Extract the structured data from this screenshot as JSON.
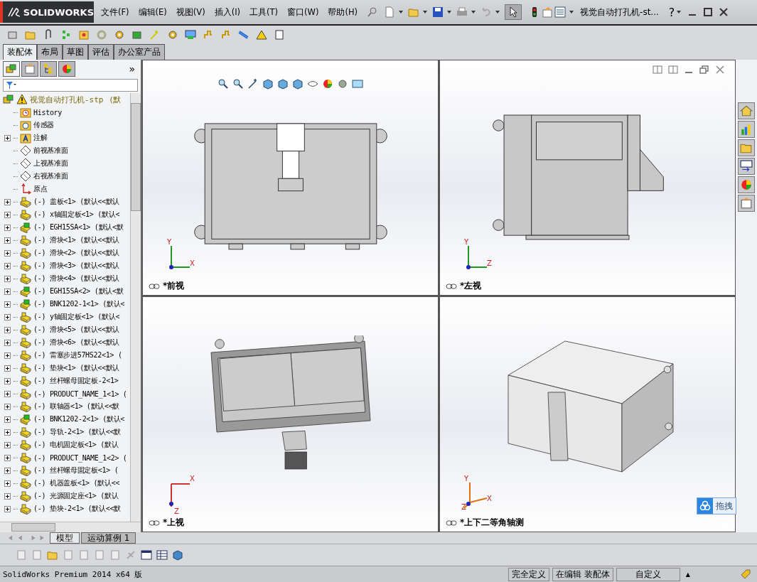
{
  "window": {
    "logo": "SOLIDWORKS",
    "title": "视觉自动打孔机-st...",
    "help": "?"
  },
  "menus": [
    "文件(F)",
    "编辑(E)",
    "视图(V)",
    "插入(I)",
    "工具(T)",
    "窗口(W)",
    "帮助(H)"
  ],
  "command_tabs": [
    {
      "label": "装配体",
      "selected": true
    },
    {
      "label": "布局",
      "selected": false
    },
    {
      "label": "草图",
      "selected": false
    },
    {
      "label": "评估",
      "selected": false
    },
    {
      "label": "办公室产品",
      "selected": false
    }
  ],
  "manager_tabs": [
    {
      "kind": "assembly",
      "selected": true
    },
    {
      "kind": "property",
      "selected": false
    },
    {
      "kind": "config",
      "selected": false
    },
    {
      "kind": "display",
      "selected": false
    }
  ],
  "manager_more": "»",
  "tree": {
    "root": {
      "label": "视觉自动打孔机-stp",
      "config": "(默",
      "warning": true
    },
    "items": [
      {
        "kind": "history",
        "label": "History",
        "expandable": false
      },
      {
        "kind": "sensor",
        "label": "传感器",
        "expandable": false
      },
      {
        "kind": "annotation",
        "label": "注解",
        "expandable": true
      },
      {
        "kind": "plane",
        "label": "前视基准面",
        "expandable": false
      },
      {
        "kind": "plane",
        "label": "上视基准面",
        "expandable": false
      },
      {
        "kind": "plane",
        "label": "右视基准面",
        "expandable": false
      },
      {
        "kind": "origin",
        "label": "原点",
        "expandable": false
      },
      {
        "kind": "part",
        "label": "(-) 盖板<1> (默认<<默认",
        "expandable": true
      },
      {
        "kind": "part",
        "label": "(-) x轴固定板<1> (默认<",
        "expandable": true
      },
      {
        "kind": "assembly",
        "label": "(-) EGH15SA<1> (默认<默",
        "expandable": true
      },
      {
        "kind": "part",
        "label": "(-) 滑块<1> (默认<<默认",
        "expandable": true
      },
      {
        "kind": "part",
        "label": "(-) 滑块<2> (默认<<默认",
        "expandable": true
      },
      {
        "kind": "part",
        "label": "(-) 滑块<3> (默认<<默认",
        "expandable": true
      },
      {
        "kind": "part",
        "label": "(-) 滑块<4> (默认<<默认",
        "expandable": true
      },
      {
        "kind": "assembly",
        "label": "(-) EGH15SA<2> (默认<默",
        "expandable": true
      },
      {
        "kind": "assembly",
        "label": "(-) BNK1202-1<1> (默认<",
        "expandable": true
      },
      {
        "kind": "part",
        "label": "(-) y轴固定板<1> (默认<",
        "expandable": true
      },
      {
        "kind": "part",
        "label": "(-) 滑块<5> (默认<<默认",
        "expandable": true
      },
      {
        "kind": "part",
        "label": "(-) 滑块<6> (默认<<默认",
        "expandable": true
      },
      {
        "kind": "part",
        "label": "(-) 雷塞步进57HS22<1> (",
        "expandable": true
      },
      {
        "kind": "part",
        "label": "(-) 垫块<1> (默认<<默认",
        "expandable": true
      },
      {
        "kind": "part",
        "label": "(-) 丝杆螺母固定板-2<1>",
        "expandable": true
      },
      {
        "kind": "part",
        "label": "(-) PRODUCT_NAME_1<1> (",
        "expandable": true
      },
      {
        "kind": "part",
        "label": "(-) 联轴器<1> (默认<<默",
        "expandable": true
      },
      {
        "kind": "assembly",
        "label": "(-) BNK1202-2<1> (默认<",
        "expandable": true
      },
      {
        "kind": "part",
        "label": "(-) 导轨-2<1> (默认<<默",
        "expandable": true
      },
      {
        "kind": "part",
        "label": "(-) 电机固定板<1> (默认",
        "expandable": true
      },
      {
        "kind": "part",
        "label": "(-) PRODUCT_NAME_1<2> (",
        "expandable": true
      },
      {
        "kind": "part",
        "label": "(-) 丝杆螺母固定板<1> (",
        "expandable": true
      },
      {
        "kind": "part",
        "label": "(-) 机器盖板<1> (默认<<",
        "expandable": true
      },
      {
        "kind": "part",
        "label": "(-) 光源固定座<1> (默认",
        "expandable": true
      },
      {
        "kind": "part",
        "label": "(-) 垫块-2<1> (默认<<默",
        "expandable": true
      }
    ]
  },
  "viewports": [
    {
      "kind": "front",
      "label": "*前视",
      "axes": [
        "Y",
        "X"
      ]
    },
    {
      "kind": "left",
      "label": "*左视",
      "axes": [
        "Y",
        "Z"
      ]
    },
    {
      "kind": "top",
      "label": "*上视",
      "axes": [
        "X",
        "Z"
      ]
    },
    {
      "kind": "iso",
      "label": "*上下二等角轴测",
      "axes": [
        "Y",
        "X",
        "Z"
      ]
    }
  ],
  "float_button": "拖拽",
  "bottom_tabs": [
    {
      "label": "模型",
      "selected": true
    },
    {
      "label": "运动算例 1",
      "selected": false
    }
  ],
  "status_bar": [
    "SolidWorks Premium 2014 x64 版",
    "完全定义",
    "在编辑 装配体",
    "自定义"
  ],
  "status_caret": "▲"
}
